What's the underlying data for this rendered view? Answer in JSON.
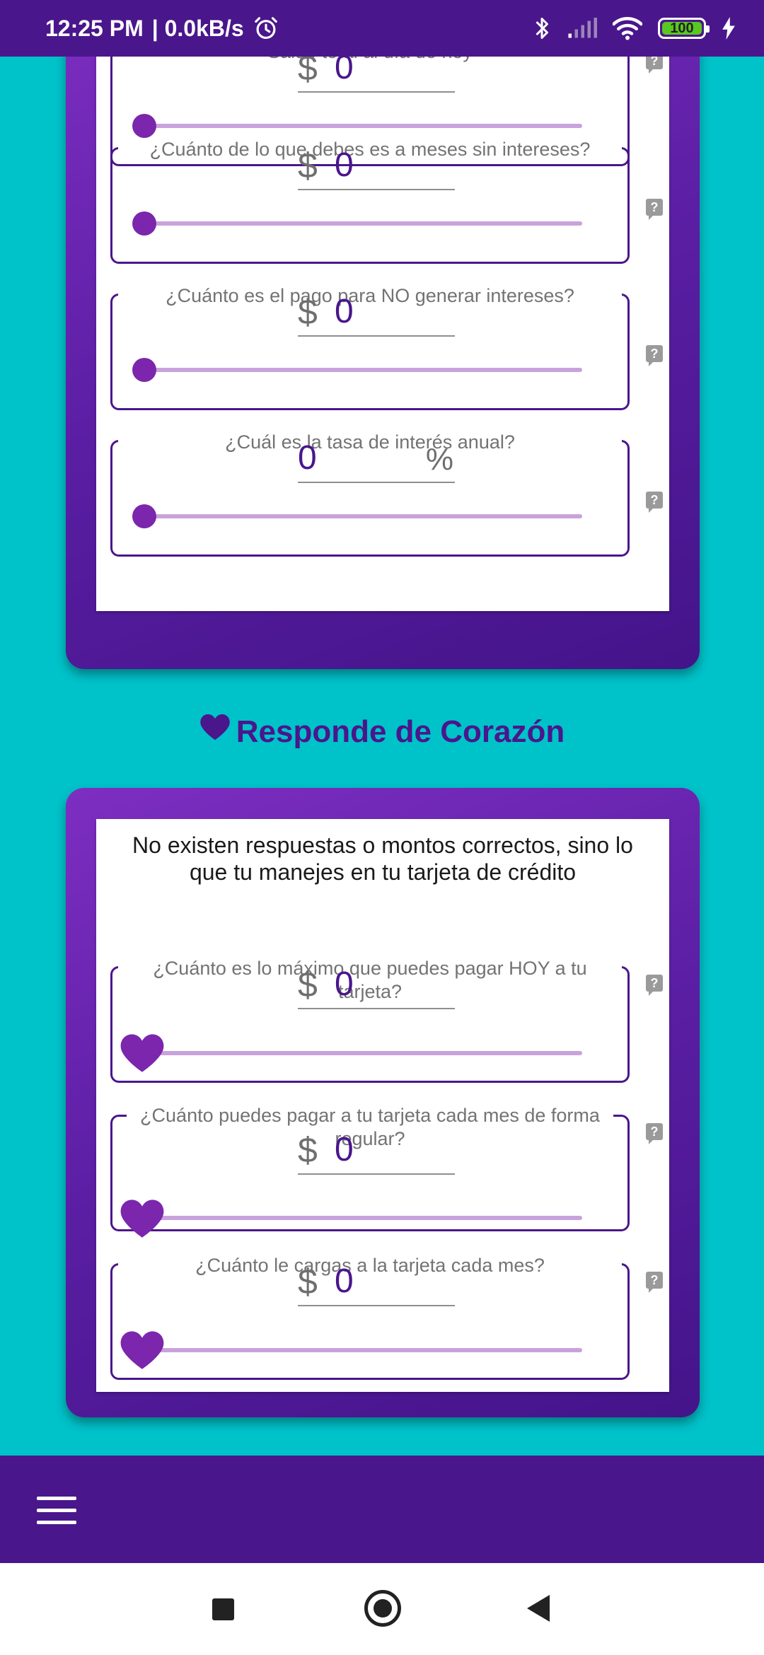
{
  "status_bar": {
    "time": "12:25 PM",
    "speed": "| 0.0kB/s",
    "battery": "100",
    "icons": [
      "alarm-icon",
      "bluetooth-icon",
      "signal-icon",
      "wifi-icon",
      "battery-icon",
      "charging-icon"
    ]
  },
  "colors": {
    "background": "#00c2c9",
    "primary": "#4a168c",
    "accent": "#7b26ad",
    "track": "#c9a2dc"
  },
  "card1": {
    "fields": [
      {
        "label": "Saldo total al día de hoy",
        "currency": "$",
        "value": "0",
        "slider_fraction": 0
      },
      {
        "label": "¿Cuánto de lo que debes es a meses sin intereses?",
        "currency": "$",
        "value": "0",
        "slider_fraction": 0
      },
      {
        "label": "¿Cuánto es el pago para NO generar intereses?",
        "currency": "$",
        "value": "0",
        "slider_fraction": 0
      },
      {
        "label": "¿Cuál es la tasa de interés anual?",
        "value": "0",
        "suffix": "%",
        "slider_fraction": 0
      }
    ]
  },
  "section": {
    "title": "Responde de Corazón",
    "icon": "heart-icon"
  },
  "card2": {
    "intro": "No existen respuestas o montos correctos, sino lo que tu manejes en tu tarjeta de crédito",
    "fields": [
      {
        "label": "¿Cuánto es lo máximo que puedes pagar HOY a tu tarjeta?",
        "currency": "$",
        "value": "0",
        "slider_fraction": 0
      },
      {
        "label": "¿Cuánto puedes pagar a tu tarjeta cada mes de forma regular?",
        "currency": "$",
        "value": "0",
        "slider_fraction": 0
      },
      {
        "label": "¿Cuánto le cargas a la tarjeta cada mes?",
        "currency": "$",
        "value": "0",
        "slider_fraction": 0
      }
    ]
  },
  "help_icon": "?",
  "bottom_bar": {
    "menu_icon": "hamburger-menu-icon"
  },
  "nav_bar": {
    "icons": [
      "recent-apps-icon",
      "home-icon",
      "back-icon"
    ]
  }
}
